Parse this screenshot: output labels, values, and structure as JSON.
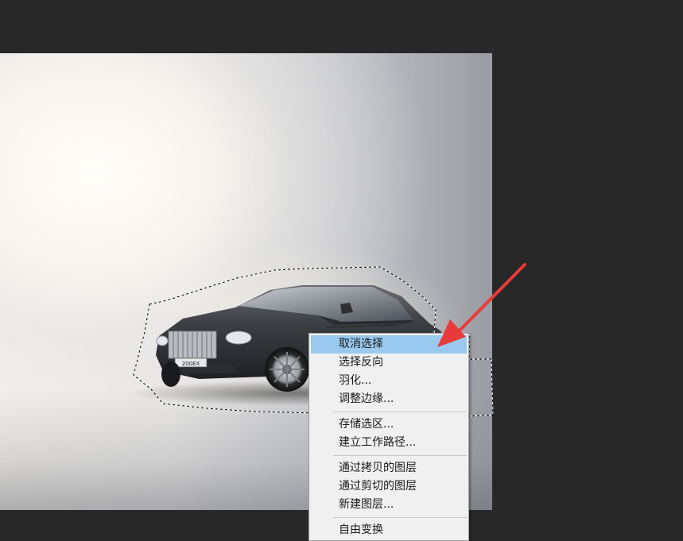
{
  "colors": {
    "workspace_bg": "#282828",
    "menu_bg": "#f0f0f0",
    "menu_highlight": "#99c9ef",
    "arrow": "#e83a3a"
  },
  "car": {
    "plate_text": "200EX"
  },
  "context_menu": {
    "groups": [
      [
        {
          "label": "取消选择",
          "highlighted": true
        },
        {
          "label": "选择反向",
          "highlighted": false
        },
        {
          "label": "羽化...",
          "highlighted": false
        },
        {
          "label": "调整边缘...",
          "highlighted": false
        }
      ],
      [
        {
          "label": "存储选区...",
          "highlighted": false
        },
        {
          "label": "建立工作路径...",
          "highlighted": false
        }
      ],
      [
        {
          "label": "通过拷贝的图层",
          "highlighted": false
        },
        {
          "label": "通过剪切的图层",
          "highlighted": false
        },
        {
          "label": "新建图层...",
          "highlighted": false
        }
      ],
      [
        {
          "label": "自由变换",
          "highlighted": false
        }
      ]
    ]
  },
  "annotation": {
    "arrow_icon": "red-arrow-pointer"
  }
}
